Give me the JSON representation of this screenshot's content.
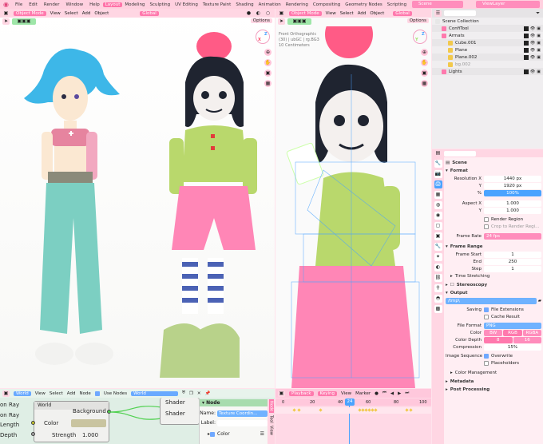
{
  "menu": {
    "items": [
      "File",
      "Edit",
      "Render",
      "Window",
      "Help"
    ],
    "workspaces": [
      "Layout",
      "Modeling",
      "Sculpting",
      "UV Editing",
      "Texture Paint",
      "Shading",
      "Animation",
      "Rendering",
      "Compositing",
      "Geometry Nodes",
      "Scripting"
    ],
    "active_workspace": "Layout",
    "scene": "Scene",
    "view_layer": "ViewLayer"
  },
  "viewport_left": {
    "mode": "Object Mode",
    "menus": [
      "View",
      "Select",
      "Add",
      "Object"
    ],
    "orientation": "Global",
    "options_label": "Options"
  },
  "viewport_mid": {
    "mode": "Object Mode",
    "menus": [
      "View",
      "Select",
      "Add",
      "Object"
    ],
    "orientation": "Global",
    "options_label": "Options",
    "overlay_lines": [
      "Front Orthographic",
      "(30) | ubGC | rg.BG3",
      "10 Centimeters"
    ]
  },
  "outliner": {
    "title": "Scene Collection",
    "rows": [
      {
        "label": "Scene Collection",
        "indent": 0,
        "color": "#e7e7e7",
        "checks": false
      },
      {
        "label": "ConfiTool",
        "indent": 1,
        "color": "#ff79ad",
        "checks": true
      },
      {
        "label": "Armats",
        "indent": 1,
        "color": "#ff79ad",
        "checks": true
      },
      {
        "label": "Cube.001",
        "indent": 2,
        "color": "#f2c94c",
        "checks": true
      },
      {
        "label": "Plane",
        "indent": 2,
        "color": "#f2c94c",
        "checks": true
      },
      {
        "label": "Plane.002",
        "indent": 2,
        "color": "#f2c94c",
        "checks": true
      },
      {
        "label": "bg.002",
        "indent": 2,
        "color": "#f2c94c",
        "checks": false
      },
      {
        "label": "Lights",
        "indent": 1,
        "color": "#ff79ad",
        "checks": true
      }
    ]
  },
  "properties": {
    "breadcrumb": "Scene",
    "format": {
      "title": "Format",
      "res_x_label": "Resolution X",
      "res_x": "1440 px",
      "res_y_label": "Y",
      "res_y": "1920 px",
      "pct_label": "%",
      "pct": "100%",
      "aspect_x_label": "Aspect X",
      "aspect_x": "1.000",
      "aspect_y_label": "Y",
      "aspect_y": "1.000",
      "render_region": "Render Region",
      "crop": "Crop to Render Regi...",
      "frame_rate_label": "Frame Rate",
      "frame_rate": "24 fps"
    },
    "frame_range": {
      "title": "Frame Range",
      "start_label": "Frame Start",
      "start": "1",
      "end_label": "End",
      "end": "250",
      "step_label": "Step",
      "step": "1"
    },
    "time_stretching": "Time Stretching",
    "stereoscopy": "Stereoscopy",
    "output": {
      "title": "Output",
      "path": "/tmp\\",
      "saving_label": "Saving",
      "file_ext": "File Extensions",
      "cache": "Cache Result",
      "file_format_label": "File Format",
      "file_format": "PNG",
      "color_label": "Color",
      "color_opts": [
        "BW",
        "RGB",
        "RGBA"
      ],
      "depth_label": "Color Depth",
      "depth_opts": [
        "8",
        "16"
      ],
      "compression_label": "Compression",
      "compression": "15%",
      "seq_label": "Image Sequence",
      "overwrite": "Overwrite",
      "placeholders": "Placeholders",
      "color_mgmt": "Color Management"
    },
    "metadata": "Metadata",
    "post": "Post Processing"
  },
  "node_editor": {
    "world_label": "World",
    "menus": [
      "View",
      "Select",
      "Add",
      "Node"
    ],
    "use_nodes": "Use Nodes",
    "world_name": "World",
    "left_sockets": [
      "on Ray",
      "on Ray",
      "Length",
      "Depth"
    ],
    "world_node_title": "World",
    "bg_node_title": "Background",
    "bg_color_label": "Color",
    "bg_strength_label": "Strength",
    "bg_strength": "1.000",
    "shader_labels": [
      "Shader",
      "Shader"
    ],
    "panel_title": "Node",
    "panel_name_label": "Name:",
    "panel_name": "Texture Coordin...",
    "panel_label_label": "Label:",
    "panel_color": "Color",
    "side_tabs": [
      "Node",
      "Tool",
      "View"
    ]
  },
  "timeline": {
    "menus": [
      "Playback",
      "Keying",
      "View",
      "Marker"
    ],
    "current_frame": "24",
    "ruler": [
      "0",
      "20",
      "40",
      "60",
      "80",
      "100"
    ]
  },
  "colors": {
    "accent": "#ff79ad",
    "header": "#ffd6e3",
    "selected": "#4aa3ff"
  }
}
